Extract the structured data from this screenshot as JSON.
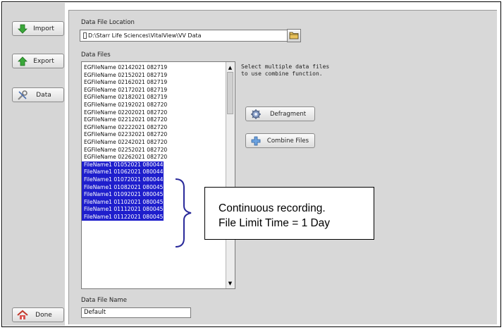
{
  "sidebar": {
    "buttons": [
      {
        "label": "Import",
        "icon": "arrow-down-icon"
      },
      {
        "label": "Export",
        "icon": "arrow-up-icon"
      },
      {
        "label": "Data",
        "icon": "tools-icon"
      },
      {
        "label": "Done",
        "icon": "home-icon"
      }
    ]
  },
  "location": {
    "caption": "Data File Location",
    "path": "D:\\Starr Life Sciences\\VitalView\\VV Data"
  },
  "files": {
    "caption": "Data Files",
    "items": [
      {
        "name": "EGFileName 02142021 082719",
        "selected": false
      },
      {
        "name": "EGFileName 02152021 082719",
        "selected": false
      },
      {
        "name": "EGFileName 02162021 082719",
        "selected": false
      },
      {
        "name": "EGFileName 02172021 082719",
        "selected": false
      },
      {
        "name": "EGFileName 02182021 082719",
        "selected": false
      },
      {
        "name": "EGFileName 02192021 082720",
        "selected": false
      },
      {
        "name": "EGFileName 02202021 082720",
        "selected": false
      },
      {
        "name": "EGFileName 02212021 082720",
        "selected": false
      },
      {
        "name": "EGFileName 02222021 082720",
        "selected": false
      },
      {
        "name": "EGFileName 02232021 082720",
        "selected": false
      },
      {
        "name": "EGFileName 02242021 082720",
        "selected": false
      },
      {
        "name": "EGFileName 02252021 082720",
        "selected": false
      },
      {
        "name": "EGFileName 02262021 082720",
        "selected": false
      },
      {
        "name": "FileName1 01052021 080044",
        "selected": true
      },
      {
        "name": "FileName1 01062021 080044",
        "selected": true
      },
      {
        "name": "FileName1 01072021 080044",
        "selected": true
      },
      {
        "name": "FileName1 01082021 080045",
        "selected": true
      },
      {
        "name": "FileName1 01092021 080045",
        "selected": true
      },
      {
        "name": "FileName1 01102021 080045",
        "selected": true
      },
      {
        "name": "FileName1 01112021 080045",
        "selected": true
      },
      {
        "name": "FileName1 01122021 080045",
        "selected": true
      }
    ]
  },
  "hint": "Select multiple data files\nto use combine function.",
  "actions": {
    "defragment": "Defragment",
    "combine": "Combine Files"
  },
  "name_field": {
    "caption": "Data File Name",
    "value": "Default"
  },
  "annotation": {
    "line1": "Continuous recording.",
    "line2": "File Limit Time = 1 Day"
  },
  "colors": {
    "selection": "#1e1ecc",
    "annotation_brace": "#2a2a9a",
    "panel_bg": "#d8d8d8"
  }
}
